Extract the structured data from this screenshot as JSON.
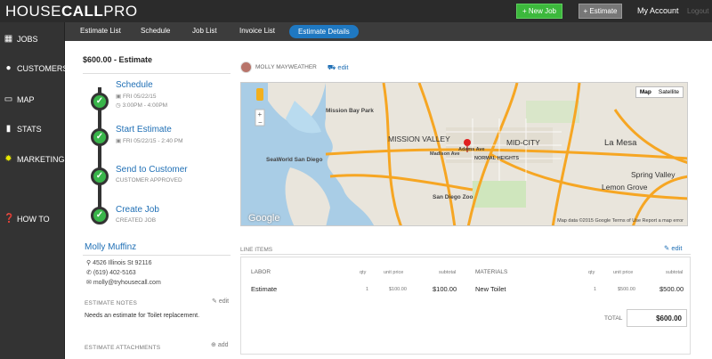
{
  "app": {
    "logo_light": "HOUSE",
    "logo_bold": "CALL",
    "logo_end": "PRO"
  },
  "topbar": {
    "new_job": "+ New Job",
    "estimate": "+ Estimate",
    "account": "My Account",
    "logout": "Logout"
  },
  "sidebar": {
    "items": [
      {
        "label": "JOBS",
        "icon": "calendar-icon"
      },
      {
        "label": "CUSTOMERS",
        "icon": "person-icon"
      },
      {
        "label": "MAP",
        "icon": "map-icon"
      },
      {
        "label": "STATS",
        "icon": "bar-chart-icon"
      },
      {
        "label": "MARKETING",
        "icon": "gear-icon"
      },
      {
        "label": "HOW TO",
        "icon": "help-icon"
      }
    ]
  },
  "subnav": {
    "tabs": [
      "Estimate List",
      "Schedule",
      "Job List",
      "Invoice List",
      "Estimate Details"
    ],
    "active": "Estimate Details"
  },
  "estimate": {
    "title": "$600.00 - Estimate",
    "steps": [
      {
        "title": "Schedule",
        "line1": "FRI 05/22/15",
        "line2": "3:00PM - 4:00PM"
      },
      {
        "title": "Start Estimate",
        "line1": "FRI 05/22/15 - 2:40 PM"
      },
      {
        "title": "Send to Customer",
        "line1": "CUSTOMER APPROVED"
      },
      {
        "title": "Create Job",
        "line1": "CREATED JOB"
      }
    ]
  },
  "customer": {
    "name": "Molly Muffinz",
    "address": "4526 Illinois St 92116",
    "phone": "(619) 402-5163",
    "email": "molly@tryhousecall.com",
    "notes_label": "ESTIMATE NOTES",
    "notes_edit": "edit",
    "notes": "Needs an estimate for Toilet replacement.",
    "attachments_label": "ESTIMATE ATTACHMENTS",
    "attachments_add": "add"
  },
  "owner": {
    "name": "MOLLY MAYWEATHER",
    "edit": "edit"
  },
  "map": {
    "btn_map": "Map",
    "btn_satellite": "Satellite",
    "footer": "Map data ©2015 Google   Terms of Use   Report a map error",
    "google": "Google",
    "labels": [
      "MISSION VALLEY",
      "MID-CITY",
      "La Mesa",
      "Lemon Grove",
      "Spring Valley",
      "Mission Bay Park",
      "SeaWorld San Diego",
      "San Diego Zoo",
      "Adams Ave",
      "NORMAL HEIGHTS",
      "Madison Ave"
    ]
  },
  "line_items": {
    "label": "LINE ITEMS",
    "edit": "edit",
    "labor": {
      "header": "LABOR",
      "qty_h": "qty",
      "price_h": "unit price",
      "sub_h": "subtotal",
      "name": "Estimate",
      "qty": "1",
      "price": "$100.00",
      "subtotal": "$100.00"
    },
    "materials": {
      "header": "MATERIALS",
      "qty_h": "qty",
      "price_h": "unit price",
      "sub_h": "subtotal",
      "name": "New Toilet",
      "qty": "1",
      "price": "$500.00",
      "subtotal": "$500.00"
    },
    "total_label": "TOTAL",
    "total": "$600.00"
  },
  "colors": {
    "accent": "#1f78c1",
    "green": "#39b54a",
    "new_job": "#3cb83c"
  }
}
